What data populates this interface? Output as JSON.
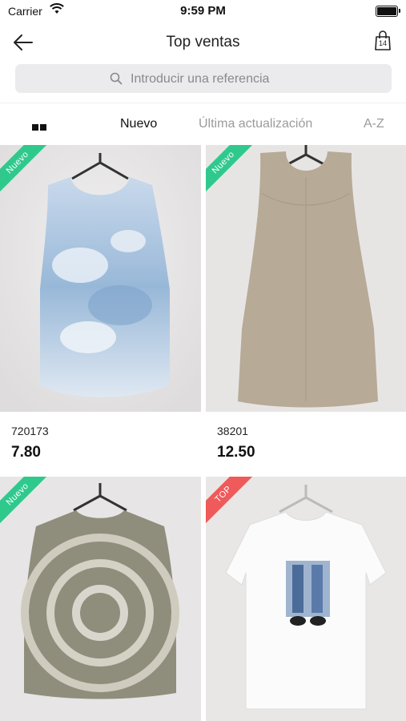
{
  "status_bar": {
    "carrier": "Carrier",
    "time": "9:59 PM"
  },
  "header": {
    "title": "Top ventas",
    "back_icon": "back-arrow-icon",
    "cart_icon": "shopping-bag-icon",
    "cart_count": "14"
  },
  "search": {
    "placeholder": "Introducir una referencia",
    "value": ""
  },
  "sort": {
    "options": [
      "Nuevo",
      "Última actualización",
      "A-Z"
    ],
    "selected": "Nuevo"
  },
  "colors": {
    "badge_new": "#2fc98d",
    "badge_top": "#ef5a5a",
    "sort_inactive": "#9b9b9b"
  },
  "products": [
    {
      "badge": "Nuevo",
      "reference": "720173",
      "price": "7.80"
    },
    {
      "badge": "Nuevo",
      "reference": "38201",
      "price": "12.50"
    },
    {
      "badge": "Nuevo",
      "reference": "",
      "price": ""
    },
    {
      "badge": "TOP",
      "reference": "",
      "price": ""
    }
  ]
}
